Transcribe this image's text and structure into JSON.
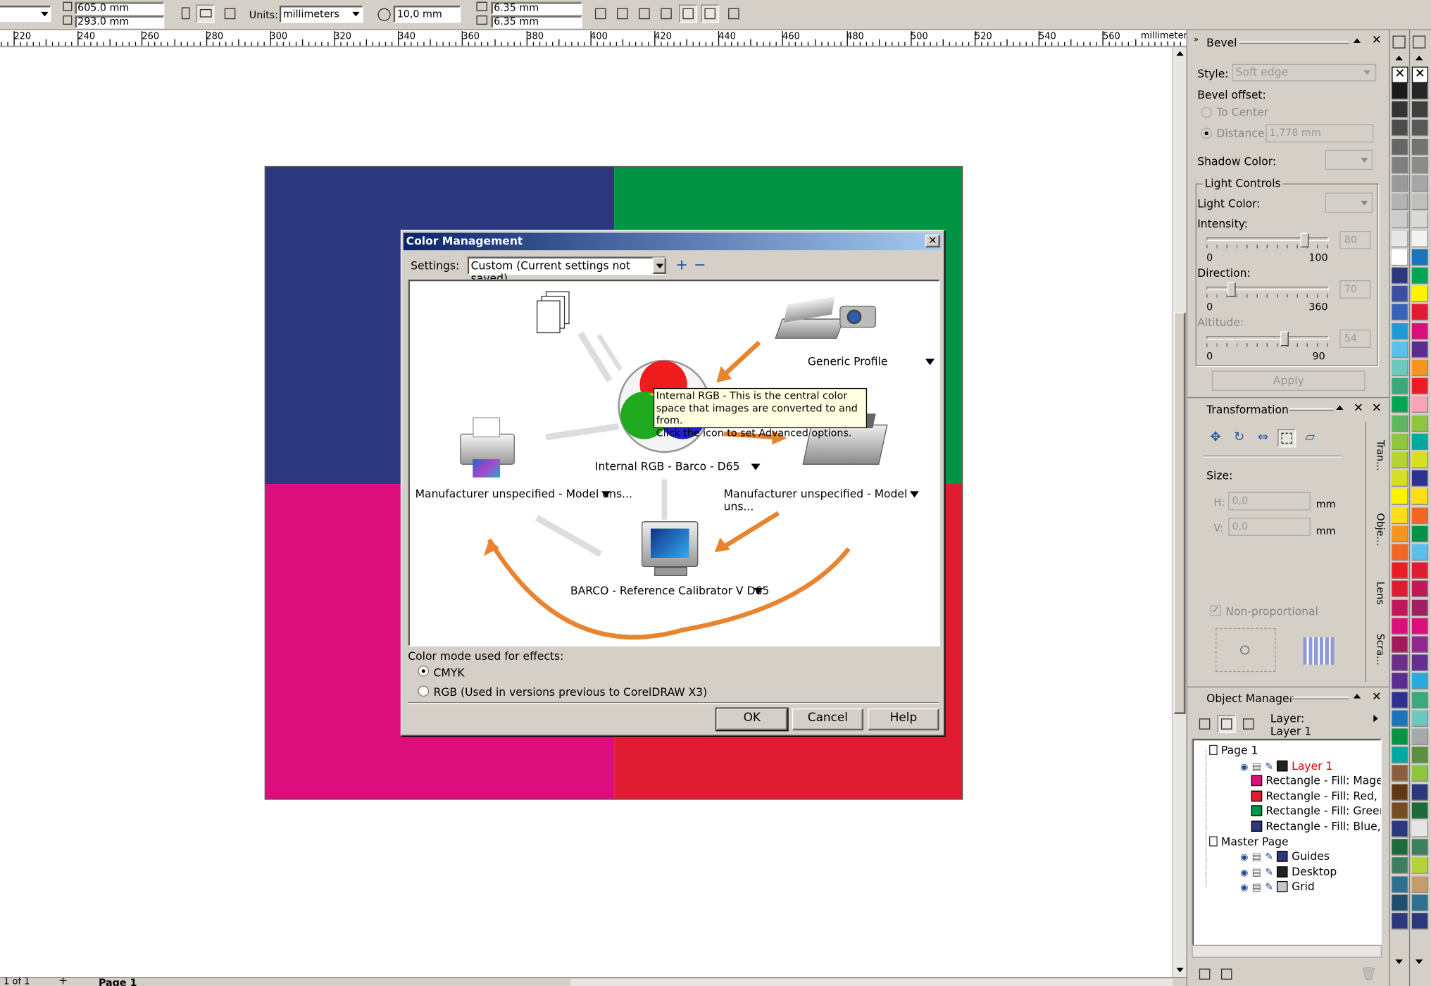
{
  "toolbar": {
    "width_value": "605.0 mm",
    "height_value": "293.0 mm",
    "units_label": "Units:",
    "units_value": "millimeters",
    "nudge_value": "10,0 mm",
    "dup_x_value": "6.35 mm",
    "dup_y_value": "6.35 mm"
  },
  "ruler": {
    "labels": [
      "220",
      "240",
      "260",
      "280",
      "300",
      "320",
      "340",
      "360",
      "380",
      "400",
      "420",
      "440",
      "460",
      "480",
      "500",
      "520",
      "540",
      "560"
    ],
    "unit": "millimeters"
  },
  "canvas": {
    "colors": {
      "blue": "#2c387e",
      "green": "#009444",
      "magenta": "#dc0e7c",
      "red": "#e01c33"
    }
  },
  "dialog": {
    "title": "Color Management",
    "settings_label": "Settings:",
    "settings_value": "Custom (Current settings not saved)",
    "generic_profile": "Generic Profile",
    "internal_rgb": "Internal RGB - Barco - D65",
    "manufacturer_left": "Manufacturer unspecified - Model uns...",
    "manufacturer_right": "Manufacturer unspecified - Model uns...",
    "monitor_profile": "BARCO - Reference Calibrator V D65",
    "tooltip_line1": "Internal RGB - This is the central color",
    "tooltip_line2": "space that images are converted to and from.",
    "tooltip_line3": "Click the icon to set Advanced options.",
    "color_mode_label": "Color mode used for effects:",
    "cmyk_label": "CMYK",
    "rgb_label": "RGB (Used in versions previous to CorelDRAW X3)",
    "ok_label": "OK",
    "cancel_label": "Cancel",
    "help_label": "Help"
  },
  "bevel": {
    "title": "Bevel",
    "style_label": "Style:",
    "style_value": "Soft edge",
    "offset_label": "Bevel offset:",
    "to_center": "To Center",
    "distance_label": "Distance:",
    "distance_value": "1,778 mm",
    "shadow_color_label": "Shadow Color:",
    "light_controls": "Light Controls",
    "light_color_label": "Light Color:",
    "intensity_label": "Intensity:",
    "intensity_value": "80",
    "intensity_min": "0",
    "intensity_max": "100",
    "direction_label": "Direction:",
    "direction_value": "70",
    "direction_min": "0",
    "direction_max": "360",
    "altitude_label": "Altitude:",
    "altitude_value": "54",
    "altitude_min": "0",
    "altitude_max": "90",
    "apply_label": "Apply"
  },
  "transformation": {
    "title": "Transformation",
    "size_label": "Size:",
    "h_label": "H:",
    "h_value": "0,0",
    "v_label": "V:",
    "v_value": "0,0",
    "unit": "mm",
    "nonprop_label": "Non-proportional"
  },
  "side_tabs": [
    "Tran...",
    "Obje...",
    "Lens",
    "Scra..."
  ],
  "object_manager": {
    "title": "Object Manager",
    "layer_label": "Layer:",
    "layer_value": "Layer 1",
    "tree": [
      {
        "label": "Page 1",
        "indent": 0,
        "color": null,
        "red": false
      },
      {
        "label": "Layer 1",
        "indent": 1,
        "color": "#222222",
        "red": true
      },
      {
        "label": "Rectangle - Fill: Magenta",
        "indent": 2,
        "color": "#dc0e7c",
        "red": false
      },
      {
        "label": "Rectangle - Fill: Red, Oul",
        "indent": 2,
        "color": "#e01c33",
        "red": false
      },
      {
        "label": "Rectangle - Fill: Green, C",
        "indent": 2,
        "color": "#009444",
        "red": false
      },
      {
        "label": "Rectangle - Fill: Blue, Ou",
        "indent": 2,
        "color": "#2c387e",
        "red": false
      },
      {
        "label": "Master Page",
        "indent": 0,
        "color": null,
        "red": false
      },
      {
        "label": "Guides",
        "indent": 1,
        "color": "#2c387e",
        "red": false
      },
      {
        "label": "Desktop",
        "indent": 1,
        "color": "#222222",
        "red": false
      },
      {
        "label": "Grid",
        "indent": 1,
        "color": "#c8c8c8",
        "red": false
      }
    ]
  },
  "status": {
    "page_count": "1 of 1",
    "page_tab": "Page 1"
  },
  "palette1": [
    "#1a1a1a",
    "#333333",
    "#4d4d4d",
    "#666666",
    "#808080",
    "#999999",
    "#b3b3b3",
    "#cccccc",
    "#e6e6e6",
    "#ffffff",
    "#2c387e",
    "#3a4fa0",
    "#3563b5",
    "#1f9ad6",
    "#5bc0eb",
    "#6dc8c0",
    "#3aaa7a",
    "#00a651",
    "#5cb85c",
    "#8dc63f",
    "#b5d334",
    "#d7df23",
    "#fff200",
    "#ffde17",
    "#f7941d",
    "#f26522",
    "#ed1c24",
    "#e01c33",
    "#c2185b",
    "#dc0e7c",
    "#a3195b",
    "#6d2d8a",
    "#5c2d91",
    "#2e3192",
    "#1b75bc",
    "#009444",
    "#00a99d",
    "#8b5e3c",
    "#603913",
    "#754c24",
    "#2c387e",
    "#1d6a3a",
    "#3f7f5f",
    "#2f6f8f",
    "#1e4f6f",
    "#2c387e"
  ],
  "palette2": [
    "#262626",
    "#404040",
    "#595959",
    "#737373",
    "#8c8c8c",
    "#a6a6a6",
    "#bfbfbf",
    "#d9d9d9",
    "#f2f2f2",
    "#1b75bc",
    "#00a651",
    "#fff200",
    "#e01c33",
    "#dc0e7c",
    "#5c2d91",
    "#f7941d",
    "#ed1c24",
    "#f9a3b7",
    "#8dc63f",
    "#00a99d",
    "#d7df23",
    "#2e3192",
    "#ffde17",
    "#f26522",
    "#009444",
    "#5bc0eb",
    "#e01c33",
    "#c2185b",
    "#9e1f63",
    "#dc0e7c",
    "#92278f",
    "#662d91",
    "#29abe2",
    "#3aaa7a",
    "#6dc8c0",
    "#a7a9ac",
    "#5c8f3f",
    "#8cc63f",
    "#2c387e",
    "#1d6a3a",
    "#e6e6e6",
    "#3f7f5f",
    "#b5d334",
    "#c69c6d",
    "#2f6f8f",
    "#2c387e"
  ]
}
